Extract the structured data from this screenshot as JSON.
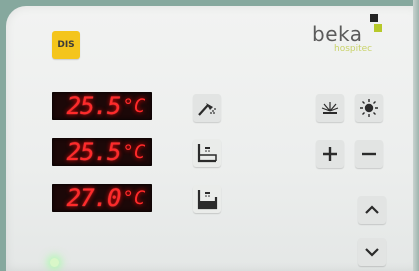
{
  "panel": {
    "dis_label": "DIS",
    "logo": {
      "word": "beka",
      "sub": "hospitec"
    }
  },
  "displays": [
    {
      "value": "25.5",
      "unit": "°C"
    },
    {
      "value": "25.5",
      "unit": "°C"
    },
    {
      "value": "27.0",
      "unit": "°C"
    }
  ],
  "icons": {
    "shower": "shower-head-icon",
    "bath_low": "bath-low-level-icon",
    "bath_full": "bath-full-icon",
    "light_dim": "dim-light-icon",
    "light_on": "light-bulb-icon",
    "plus": "plus-icon",
    "minus": "minus-icon",
    "up": "chevron-up-icon",
    "down": "chevron-down-icon"
  },
  "colors": {
    "dis_button": "#f4c51c",
    "display_digits": "#ff2a2a",
    "logo_accent": "#b7c92a",
    "status_led": "#d9f7c8"
  }
}
